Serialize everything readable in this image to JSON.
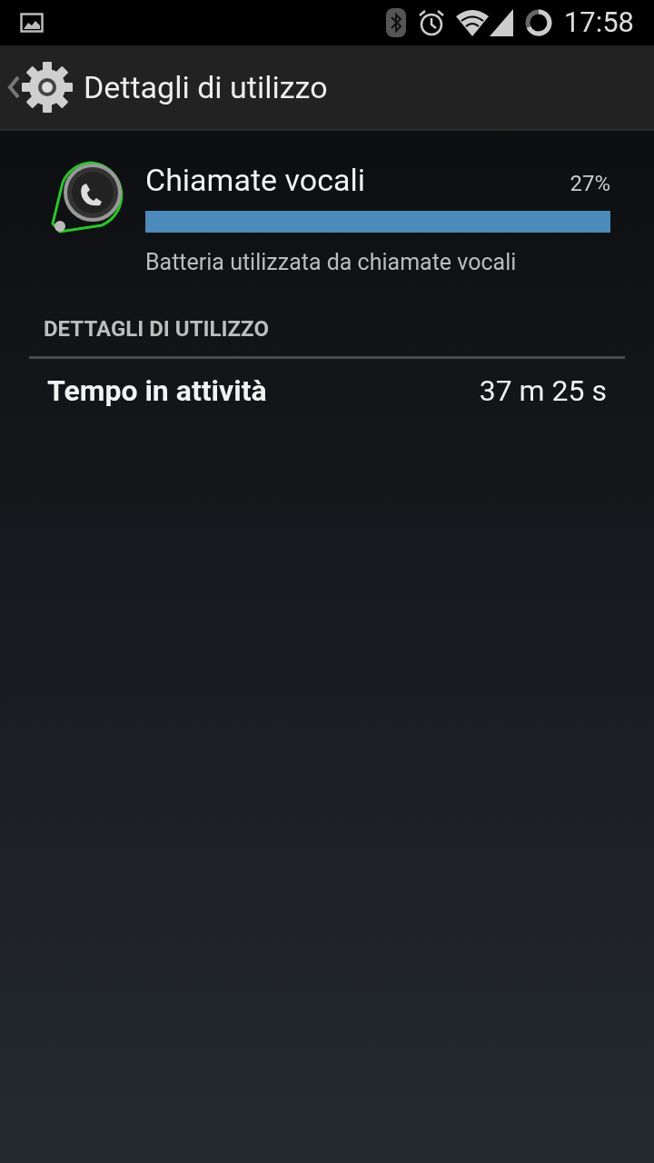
{
  "status_bar": {
    "time": "17:58"
  },
  "action_bar": {
    "title": "Dettagli di utilizzo"
  },
  "app": {
    "name": "Chiamate vocali",
    "percent": "27%",
    "description": "Batteria utilizzata da chiamate vocali"
  },
  "section": {
    "header": "DETTAGLI DI UTILIZZO"
  },
  "details": [
    {
      "label": "Tempo in attività",
      "value": "37 m 25 s"
    }
  ]
}
